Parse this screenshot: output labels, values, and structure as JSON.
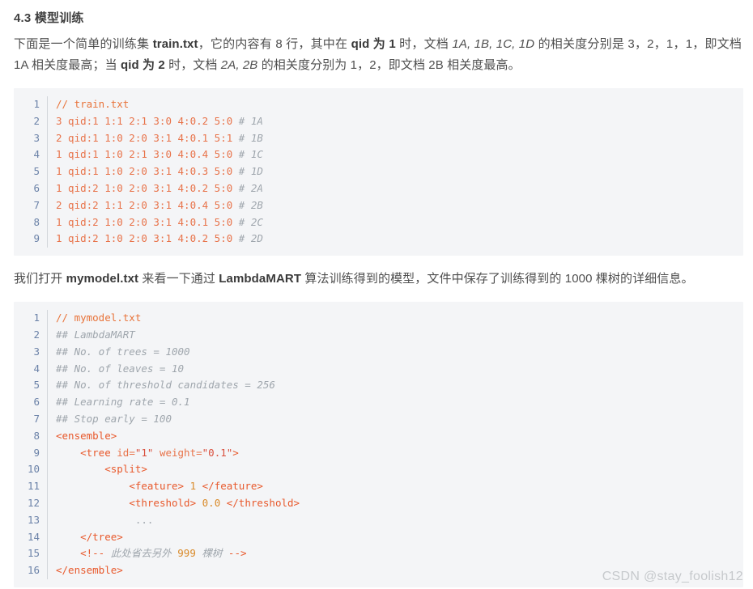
{
  "heading": "4.3 模型训练",
  "paragraphs": {
    "first": {
      "s1": "下面是一个简单的训练集 ",
      "b1": "train.txt",
      "s2": "，它的内容有 8 行，其中在 ",
      "b2": "qid 为 1",
      "s3": " 时，文档 ",
      "i1": "1A, 1B, 1C, 1D",
      "s4": " 的相关度分别是 3，2，1，1，即文档 1A 相关度最高；当 ",
      "b3": "qid 为 2",
      "s5": " 时，文档 ",
      "i2": "2A, 2B",
      "s6": " 的相关度分别为 1，2，即文档 2B 相关度最高。"
    },
    "second": {
      "s1": "我们打开 ",
      "b1": "mymodel.txt",
      "s2": " 来看一下通过 ",
      "b2": "LambdaMART",
      "s3": " 算法训练得到的模型，文件中保存了训练得到的 1000 棵树的详细信息。"
    }
  },
  "code_block_train": {
    "filename_comment": "// train.txt",
    "lines": [
      {
        "n": "1",
        "tokens": [
          {
            "t": "// train.txt",
            "c": "t-cmt-slash"
          }
        ]
      },
      {
        "n": "2",
        "tokens": [
          {
            "t": "3 qid:1 1:1 2:1 3:0 4:0.2 5:0 ",
            "c": "t-orange"
          },
          {
            "t": "# 1A",
            "c": "t-comment"
          }
        ]
      },
      {
        "n": "3",
        "tokens": [
          {
            "t": "2 qid:1 1:0 2:0 3:1 4:0.1 5:1 ",
            "c": "t-orange"
          },
          {
            "t": "# 1B",
            "c": "t-comment"
          }
        ]
      },
      {
        "n": "4",
        "tokens": [
          {
            "t": "1 qid:1 1:0 2:1 3:0 4:0.4 5:0 ",
            "c": "t-orange"
          },
          {
            "t": "# 1C",
            "c": "t-comment"
          }
        ]
      },
      {
        "n": "5",
        "tokens": [
          {
            "t": "1 qid:1 1:0 2:0 3:1 4:0.3 5:0 ",
            "c": "t-orange"
          },
          {
            "t": "# 1D",
            "c": "t-comment"
          }
        ]
      },
      {
        "n": "6",
        "tokens": [
          {
            "t": "1 qid:2 1:0 2:0 3:1 4:0.2 5:0 ",
            "c": "t-orange"
          },
          {
            "t": "# 2A",
            "c": "t-comment"
          }
        ]
      },
      {
        "n": "7",
        "tokens": [
          {
            "t": "2 qid:2 1:1 2:0 3:1 4:0.4 5:0 ",
            "c": "t-orange"
          },
          {
            "t": "# 2B",
            "c": "t-comment"
          }
        ]
      },
      {
        "n": "8",
        "tokens": [
          {
            "t": "1 qid:2 1:0 2:0 3:1 4:0.1 5:0 ",
            "c": "t-orange"
          },
          {
            "t": "# 2C",
            "c": "t-comment"
          }
        ]
      },
      {
        "n": "9",
        "tokens": [
          {
            "t": "1 qid:2 1:0 2:0 3:1 4:0.2 5:0 ",
            "c": "t-orange"
          },
          {
            "t": "# 2D",
            "c": "t-comment"
          }
        ]
      }
    ]
  },
  "code_block_model": {
    "filename_comment": "// mymodel.txt",
    "lines": [
      {
        "n": "1",
        "tokens": [
          {
            "t": "// mymodel.txt",
            "c": "t-cmt-slash"
          }
        ]
      },
      {
        "n": "2",
        "tokens": [
          {
            "t": "## LambdaMART",
            "c": "t-comment"
          }
        ]
      },
      {
        "n": "3",
        "tokens": [
          {
            "t": "## No. of trees = 1000",
            "c": "t-comment"
          }
        ]
      },
      {
        "n": "4",
        "tokens": [
          {
            "t": "## No. of leaves = 10",
            "c": "t-comment"
          }
        ]
      },
      {
        "n": "5",
        "tokens": [
          {
            "t": "## No. of threshold candidates = 256",
            "c": "t-comment"
          }
        ]
      },
      {
        "n": "6",
        "tokens": [
          {
            "t": "## Learning rate = 0.1",
            "c": "t-comment"
          }
        ]
      },
      {
        "n": "7",
        "tokens": [
          {
            "t": "## Stop early = 100",
            "c": "t-comment"
          }
        ]
      },
      {
        "n": "8",
        "tokens": [
          {
            "t": "<ensemble>",
            "c": "t-tag"
          }
        ]
      },
      {
        "n": "9",
        "tokens": [
          {
            "t": "    ",
            "c": "t-plain"
          },
          {
            "t": "<tree ",
            "c": "t-tag"
          },
          {
            "t": "id=",
            "c": "t-attr"
          },
          {
            "t": "\"1\"",
            "c": "t-str"
          },
          {
            "t": " weight=",
            "c": "t-attr"
          },
          {
            "t": "\"0.1\"",
            "c": "t-str"
          },
          {
            "t": ">",
            "c": "t-tag"
          }
        ]
      },
      {
        "n": "10",
        "tokens": [
          {
            "t": "        ",
            "c": "t-plain"
          },
          {
            "t": "<split>",
            "c": "t-tag"
          }
        ]
      },
      {
        "n": "11",
        "tokens": [
          {
            "t": "            ",
            "c": "t-plain"
          },
          {
            "t": "<feature>",
            "c": "t-tag"
          },
          {
            "t": " ",
            "c": "t-plain"
          },
          {
            "t": "1",
            "c": "t-num"
          },
          {
            "t": " ",
            "c": "t-plain"
          },
          {
            "t": "</feature>",
            "c": "t-tag"
          }
        ]
      },
      {
        "n": "12",
        "tokens": [
          {
            "t": "            ",
            "c": "t-plain"
          },
          {
            "t": "<threshold>",
            "c": "t-tag"
          },
          {
            "t": " ",
            "c": "t-plain"
          },
          {
            "t": "0.0",
            "c": "t-num"
          },
          {
            "t": " ",
            "c": "t-plain"
          },
          {
            "t": "</threshold>",
            "c": "t-tag"
          }
        ]
      },
      {
        "n": "13",
        "tokens": [
          {
            "t": "             ...",
            "c": "t-dots"
          }
        ]
      },
      {
        "n": "14",
        "tokens": [
          {
            "t": "    ",
            "c": "t-plain"
          },
          {
            "t": "</tree>",
            "c": "t-tag"
          }
        ]
      },
      {
        "n": "15",
        "tokens": [
          {
            "t": "    ",
            "c": "t-plain"
          },
          {
            "t": "<!-- ",
            "c": "t-tag"
          },
          {
            "t": "此处省去另外 ",
            "c": "t-comment"
          },
          {
            "t": "999",
            "c": "t-num"
          },
          {
            "t": " 棵树 ",
            "c": "t-comment"
          },
          {
            "t": "-->",
            "c": "t-tag"
          }
        ]
      },
      {
        "n": "16",
        "tokens": [
          {
            "t": "</ensemble>",
            "c": "t-tag"
          }
        ]
      }
    ]
  },
  "watermark": "CSDN @stay_foolish12",
  "colors": {
    "code_bg": "#f4f5f7",
    "line_number": "#6b82a8",
    "comment": "#9fa6ad",
    "tag": "#e8592c",
    "string": "#d94f3d",
    "number": "#d98b2b",
    "text": "#4d4d4d",
    "watermark": "#c6c9cc"
  }
}
